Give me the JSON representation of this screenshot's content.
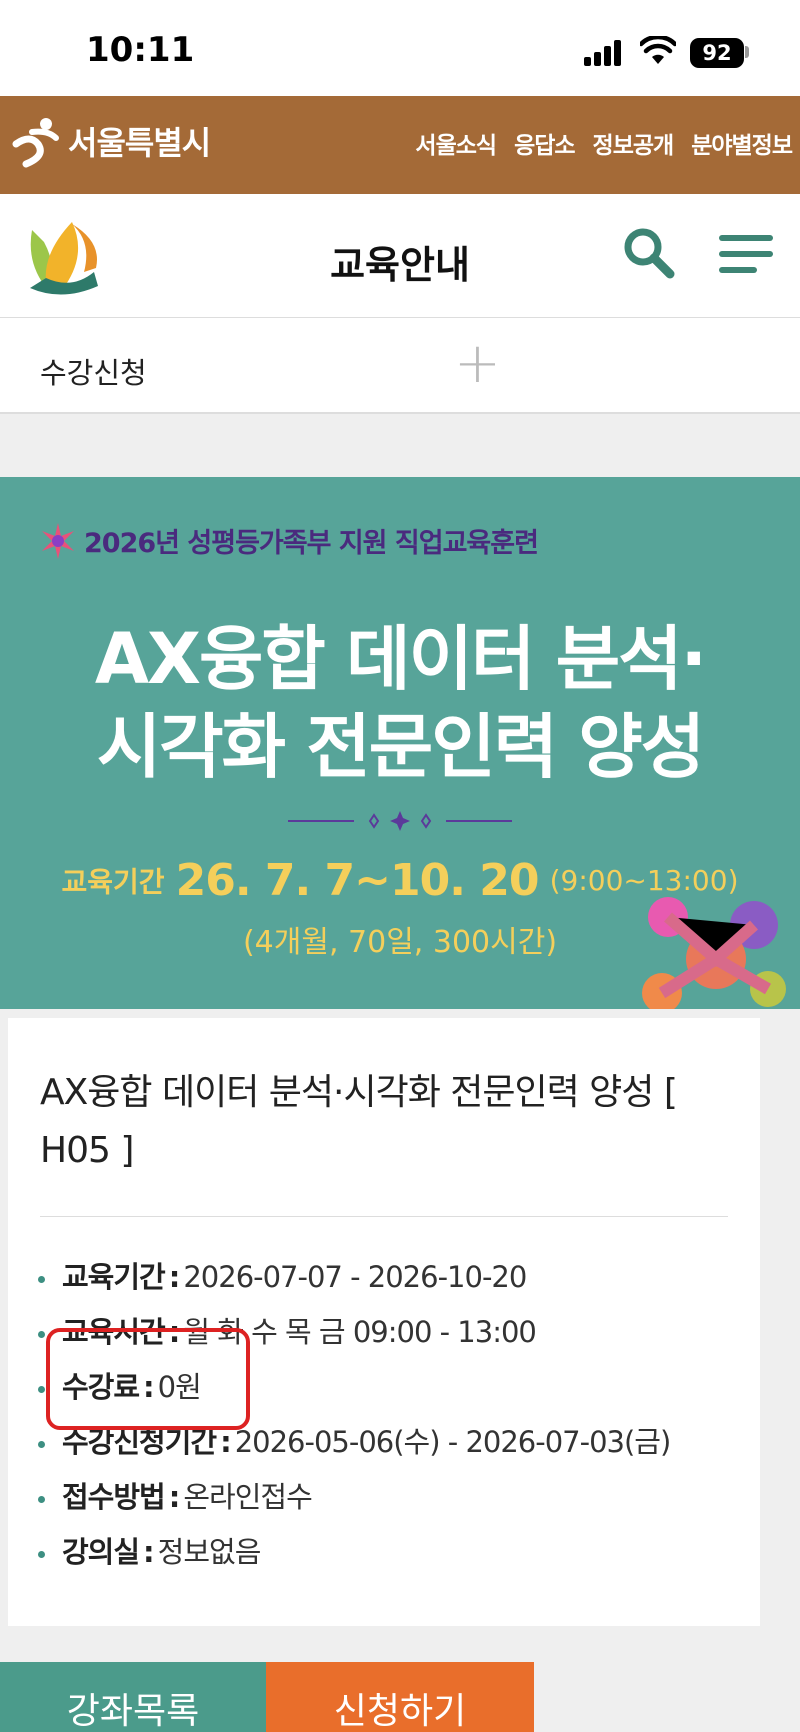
{
  "status_bar": {
    "time": "10:11",
    "battery": "92"
  },
  "seoul_bar": {
    "logo_text": "서울특별시",
    "nav": [
      "서울소식",
      "응답소",
      "정보공개",
      "분야별정보"
    ]
  },
  "header": {
    "title": "교육안내"
  },
  "accordion": {
    "label": "수강신청"
  },
  "banner": {
    "subtitle": "2026년 성평등가족부 지원 직업교육훈련",
    "title_line1": "AX융합 데이터 분석·",
    "title_line2": "시각화 전문인력 양성",
    "period_label": "교육기간",
    "period_dates": "26. 7. 7~10. 20",
    "period_time": "(9:00~13:00)",
    "duration": "(4개월, 70일, 300시간)"
  },
  "course": {
    "title": "AX융합 데이터 분석·시각화 전문인력 양성 [ H05 ]",
    "info": [
      {
        "label": "교육기간",
        "value": "2026-07-07 - 2026-10-20"
      },
      {
        "label": "교육시간",
        "value": "월 화 수 목 금 09:00 - 13:00"
      },
      {
        "label": "수강료",
        "value": "0원"
      },
      {
        "label": "수강신청기간",
        "value": "2026-05-06(수) - 2026-07-03(금)"
      },
      {
        "label": "접수방법",
        "value": "온라인접수"
      },
      {
        "label": "강의실",
        "value": "정보없음"
      }
    ]
  },
  "buttons": {
    "list": "강좌목록",
    "apply": "신청하기"
  },
  "colors": {
    "seoul_brown": "#a46a37",
    "banner_teal": "#57a499",
    "banner_yellow": "#f4cf5b",
    "banner_purple": "#4a2a7e",
    "list_button": "#4b9b8b",
    "apply_button": "#e96e2b",
    "highlight_red": "#dd2222"
  },
  "icons": [
    "seoul-logo-icon",
    "education-logo-icon",
    "search-icon",
    "hamburger-menu-icon",
    "plus-icon",
    "sparkle-icon",
    "signal-icon",
    "wifi-icon",
    "battery-icon"
  ]
}
